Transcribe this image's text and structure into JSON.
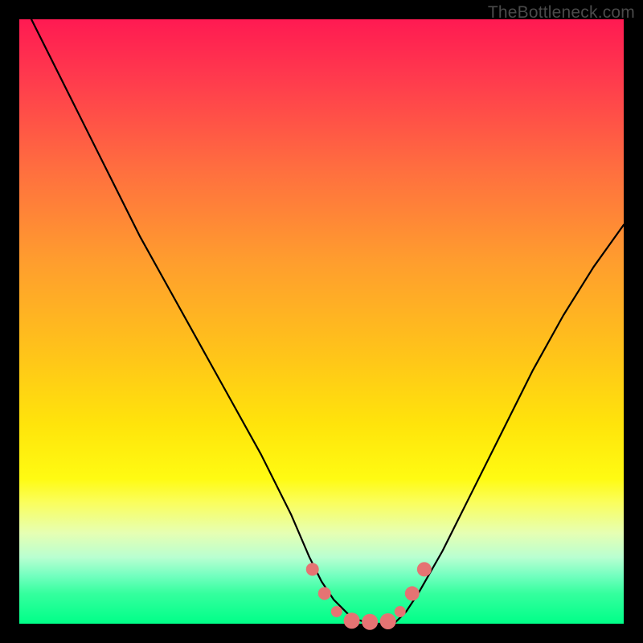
{
  "watermark": "TheBottleneck.com",
  "chart_data": {
    "type": "line",
    "title": "",
    "xlabel": "",
    "ylabel": "",
    "xlim": [
      0,
      100
    ],
    "ylim": [
      0,
      100
    ],
    "grid": false,
    "legend": false,
    "series": [
      {
        "name": "bottleneck-curve",
        "x": [
          2,
          5,
          10,
          15,
          20,
          25,
          30,
          35,
          40,
          45,
          48,
          50,
          52,
          55,
          58,
          60,
          62,
          64,
          66,
          70,
          75,
          80,
          85,
          90,
          95,
          100
        ],
        "y": [
          100,
          94,
          84,
          74,
          64,
          55,
          46,
          37,
          28,
          18,
          11,
          7,
          4,
          1,
          0,
          0,
          0,
          2,
          5,
          12,
          22,
          32,
          42,
          51,
          59,
          66
        ],
        "color": "#000000"
      }
    ],
    "markers": [
      {
        "name": "marker-a",
        "x": 48.5,
        "y": 9,
        "color": "#e57373",
        "size": 8
      },
      {
        "name": "marker-b",
        "x": 50.5,
        "y": 5,
        "color": "#e57373",
        "size": 8
      },
      {
        "name": "marker-c",
        "x": 52.5,
        "y": 2,
        "color": "#e57373",
        "size": 7
      },
      {
        "name": "marker-d",
        "x": 55,
        "y": 0.5,
        "color": "#e57373",
        "size": 10
      },
      {
        "name": "marker-e",
        "x": 58,
        "y": 0.3,
        "color": "#e57373",
        "size": 10
      },
      {
        "name": "marker-f",
        "x": 61,
        "y": 0.4,
        "color": "#e57373",
        "size": 10
      },
      {
        "name": "marker-g",
        "x": 63,
        "y": 2,
        "color": "#e57373",
        "size": 7
      },
      {
        "name": "marker-h",
        "x": 65,
        "y": 5,
        "color": "#e57373",
        "size": 9
      },
      {
        "name": "marker-i",
        "x": 67,
        "y": 9,
        "color": "#e57373",
        "size": 9
      }
    ],
    "background": "rainbow-vertical-gradient"
  }
}
